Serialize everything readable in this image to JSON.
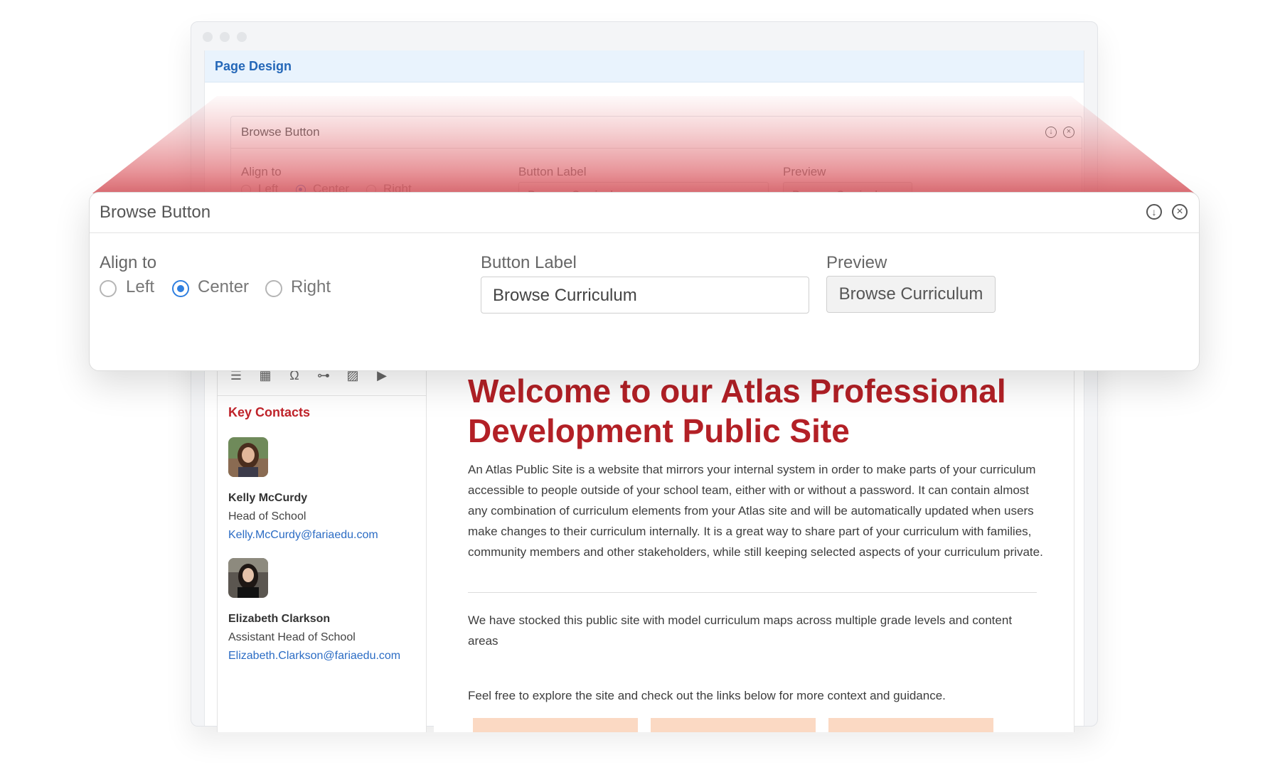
{
  "app": {
    "page_title": "Page Design"
  },
  "panel": {
    "title": "Browse Button",
    "align_label": "Align to",
    "align_options": [
      "Left",
      "Center",
      "Right"
    ],
    "align_selected": "Center",
    "button_label_title": "Button Label",
    "button_label_value": "Browse Curriculum",
    "preview_title": "Preview",
    "preview_button": "Browse Curriculum",
    "icons": [
      "download-circle-icon",
      "close-circle-icon"
    ]
  },
  "sidebar": {
    "toolbar_icons": [
      "list-icon",
      "table-icon",
      "omega-icon",
      "link-icon",
      "image-icon",
      "video-icon"
    ],
    "heading": "Key Contacts",
    "contacts": [
      {
        "name": "Kelly McCurdy",
        "role": "Head of School",
        "email": "Kelly.McCurdy@fariaedu.com"
      },
      {
        "name": "Elizabeth Clarkson",
        "role": "Assistant Head of School",
        "email": "Elizabeth.Clarkson@fariaedu.com"
      }
    ]
  },
  "content": {
    "headline": "Welcome to our Atlas Professional Development Public Site",
    "paragraph1": "An Atlas Public Site is a website that mirrors your internal system in order to make parts of your curriculum accessible to people outside of your school team, either with or without a password. It can contain almost any combination of curriculum elements from your Atlas site and will be automatically updated when users make changes to their curriculum internally. It is a great way to share part of your curriculum with families, community members and other stakeholders, while still keeping selected aspects of your curriculum private.",
    "paragraph2": "We have stocked this public site with model curriculum maps across multiple grade levels and content areas",
    "paragraph3": "Feel free to explore the site and check out the links below for more context and guidance."
  },
  "colors": {
    "accent_red": "#b32026",
    "link_blue": "#2b6cc4",
    "radio_blue": "#2f7fe0",
    "tile_peach": "#fbd9c3"
  }
}
